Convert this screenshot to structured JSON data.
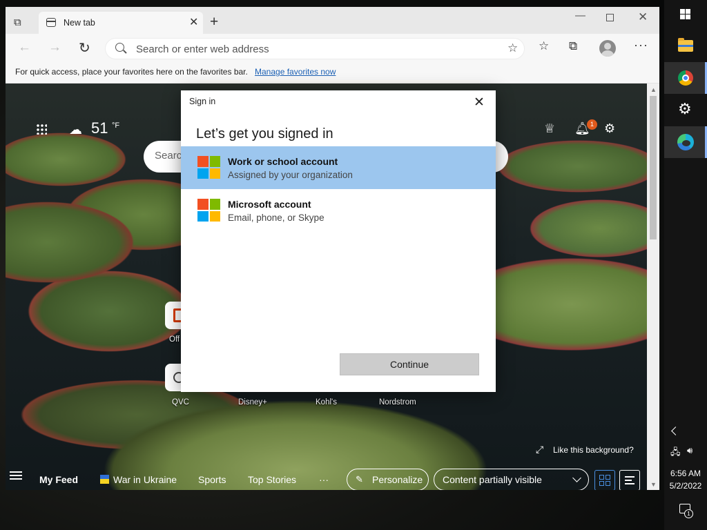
{
  "browser": {
    "tab_title": "New tab",
    "address_placeholder": "Search or enter web address",
    "favorites_bar_text": "For quick access, place your favorites here on the favorites bar.",
    "favorites_bar_link": "Manage favorites now",
    "icons": [
      "tab-actions-icon",
      "new-tab-icon",
      "minimize-icon",
      "maximize-icon",
      "close-icon",
      "back-icon",
      "forward-icon",
      "refresh-icon",
      "search-icon",
      "add-favorite-icon",
      "favorites-icon",
      "collections-icon",
      "profile-icon",
      "more-icon"
    ]
  },
  "new_tab_page": {
    "weather_temp": "51",
    "weather_unit": "°F",
    "search_placeholder": "Searc",
    "notification_count": "1",
    "quick_links": [
      {
        "label": "Off"
      },
      {
        "label": "QVC"
      },
      {
        "label": "Disney+"
      },
      {
        "label": "Kohl's"
      },
      {
        "label": "Nordstrom"
      }
    ],
    "like_background": "Like this background?",
    "feed": {
      "my_feed": "My Feed",
      "items": [
        "War in Ukraine",
        "Sports",
        "Top Stories"
      ],
      "more": "···",
      "personalize": "Personalize",
      "visibility": "Content partially visible"
    }
  },
  "dialog": {
    "caption": "Sign in",
    "heading": "Let’s get you signed in",
    "options": [
      {
        "title": "Work or school account",
        "subtitle": "Assigned by your organization",
        "selected": true
      },
      {
        "title": "Microsoft account",
        "subtitle": "Email, phone, or Skype",
        "selected": false
      }
    ],
    "continue_label": "Continue",
    "logo_colors": [
      "#f25022",
      "#7fba00",
      "#00a4ef",
      "#ffb900"
    ]
  },
  "taskbar": {
    "apps": [
      "start",
      "file-explorer",
      "chrome",
      "settings",
      "edge"
    ],
    "time": "6:56 AM",
    "date": "5/2/2022",
    "notification_count": "1"
  }
}
